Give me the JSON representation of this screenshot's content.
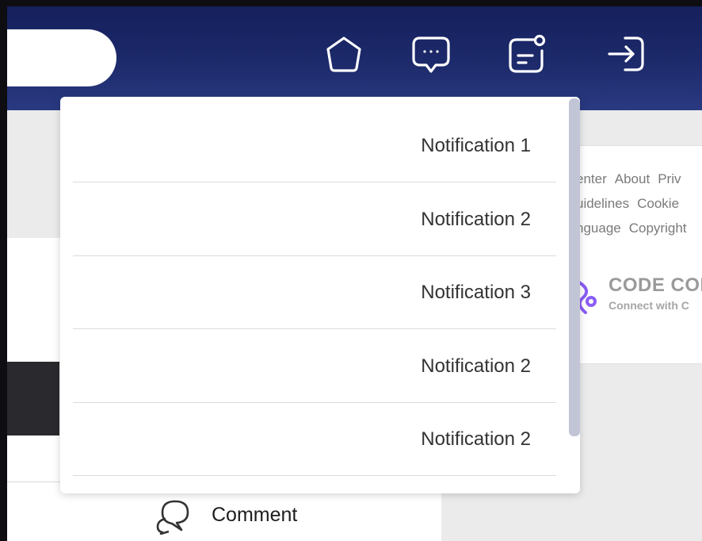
{
  "header": {
    "search": {
      "value": ""
    },
    "icons": [
      {
        "name": "home-icon"
      },
      {
        "name": "chat-icon"
      },
      {
        "name": "notification-icon"
      },
      {
        "name": "login-icon"
      }
    ]
  },
  "notifications": {
    "items": [
      {
        "label": "Notification 1"
      },
      {
        "label": "Notification 2"
      },
      {
        "label": "Notification 3"
      },
      {
        "label": "Notification 2"
      },
      {
        "label": "Notification 2"
      }
    ]
  },
  "sidebar_footer": {
    "links_row1": [
      "enter",
      "About",
      "Priv"
    ],
    "links_row2": [
      "uidelines",
      "Cookie"
    ],
    "links_row3": [
      "nguage",
      "Copyright"
    ],
    "brand": {
      "name": "CODE CON",
      "tagline": "Connect with C",
      "accent": "#8b5cf6"
    }
  },
  "post": {
    "comment_label": "Comment"
  },
  "colors": {
    "header_top": "#15205c",
    "header_bottom": "#2a3a82",
    "scrollbar": "#c2c5d6"
  }
}
